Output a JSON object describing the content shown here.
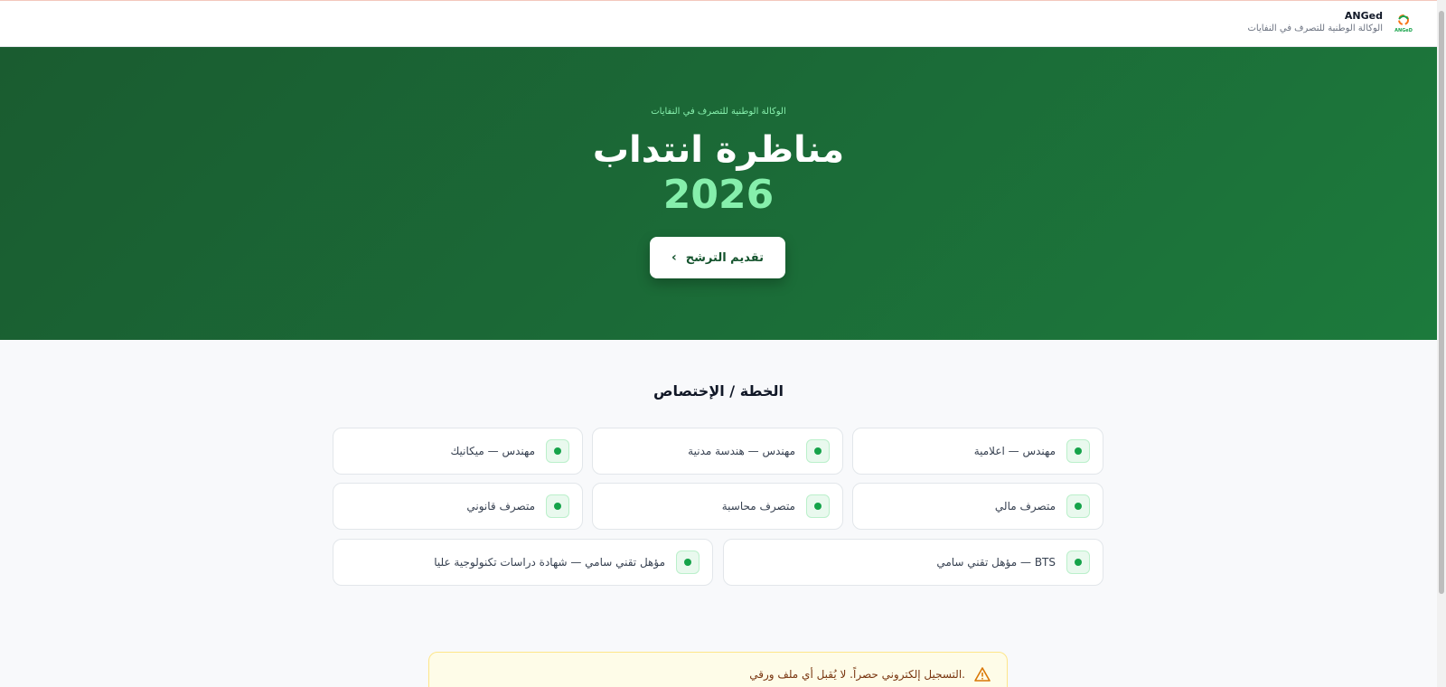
{
  "header": {
    "brand_name": "ANGed",
    "brand_subtitle": "الوكالة الوطنية للتصرف في النفايات",
    "logo_text": "ANGeD"
  },
  "hero": {
    "kicker": "الوكالة الوطنية للتصرف في النفايات",
    "title": "مناظرة انتداب",
    "year": "2026",
    "apply_label": "تقديم الترشح"
  },
  "specialties": {
    "title": "الخطة / الإختصاص",
    "items": [
      "مهندس — اعلامية",
      "مهندس — هندسة مدنية",
      "مهندس — ميكانيك",
      "متصرف مالي",
      "متصرف محاسبة",
      "متصرف قانوني",
      "مؤهل تقني سامي — BTS",
      "مؤهل تقني سامي — شهادة دراسات تكنولوجية عليا"
    ]
  },
  "notice": {
    "text": "التسجيل إلكتروني حصراً. لا يُقبل أي ملف ورقي."
  },
  "colors": {
    "hero_green": "#1b6a37",
    "accent_green": "#86efac",
    "dot_green": "#16a34a",
    "warning_bg": "#fefce8"
  }
}
